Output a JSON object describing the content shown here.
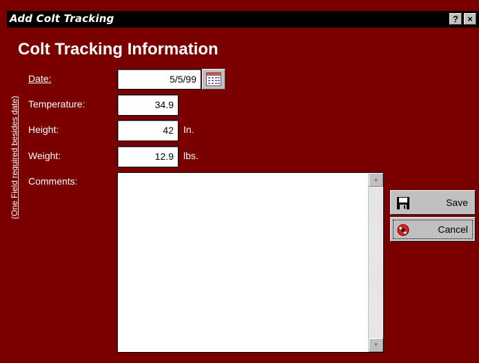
{
  "window": {
    "title": "Add Colt Tracking",
    "help_label": "?",
    "close_label": "×"
  },
  "heading": "Colt Tracking Information",
  "side_note": "(One Field required besides date)",
  "fields": {
    "date": {
      "label": "Date:",
      "value": "5/5/99"
    },
    "temperature": {
      "label": "Temperature:",
      "value": "34.9"
    },
    "height": {
      "label": "Height:",
      "value": "42",
      "unit": "In."
    },
    "weight": {
      "label": "Weight:",
      "value": "12.9",
      "unit": "lbs."
    },
    "comments": {
      "label": "Comments:",
      "value": ""
    }
  },
  "buttons": {
    "save": "Save",
    "cancel": "Cancel"
  },
  "colors": {
    "background": "#7a0000",
    "titlebar": "#000000"
  },
  "icons": [
    "calendar-icon",
    "save-disk-icon",
    "cancel-icon"
  ]
}
